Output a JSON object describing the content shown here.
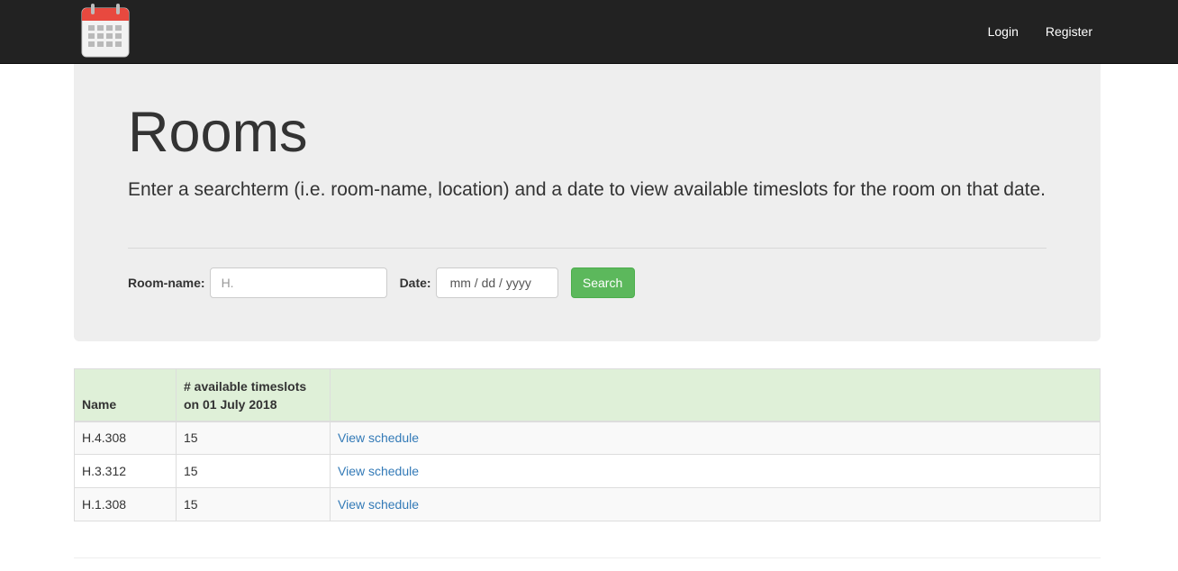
{
  "navbar": {
    "logo_icon": "calendar-icon",
    "links": [
      {
        "label": "Login"
      },
      {
        "label": "Register"
      }
    ]
  },
  "jumbotron": {
    "title": "Rooms",
    "lead": "Enter a searchterm (i.e. room-name, location) and a date to view available timeslots for the room on that date."
  },
  "search_form": {
    "room_label": "Room-name:",
    "room_placeholder": "H.",
    "room_value": "",
    "date_label": "Date:",
    "date_placeholder": "mm / dd / yyyy",
    "search_label": "Search"
  },
  "table": {
    "headers": [
      "Name",
      "# available timeslots on 01 July 2018",
      ""
    ],
    "rows": [
      {
        "name": "H.4.308",
        "count": "15",
        "link": "View schedule"
      },
      {
        "name": "H.3.312",
        "count": "15",
        "link": "View schedule"
      },
      {
        "name": "H.1.308",
        "count": "15",
        "link": "View schedule"
      }
    ]
  },
  "colors": {
    "navbar_bg": "#222222",
    "jumbotron_bg": "#eeeeee",
    "search_button": "#5cb85c",
    "table_header_bg": "#dff0d8",
    "link": "#337ab7"
  }
}
